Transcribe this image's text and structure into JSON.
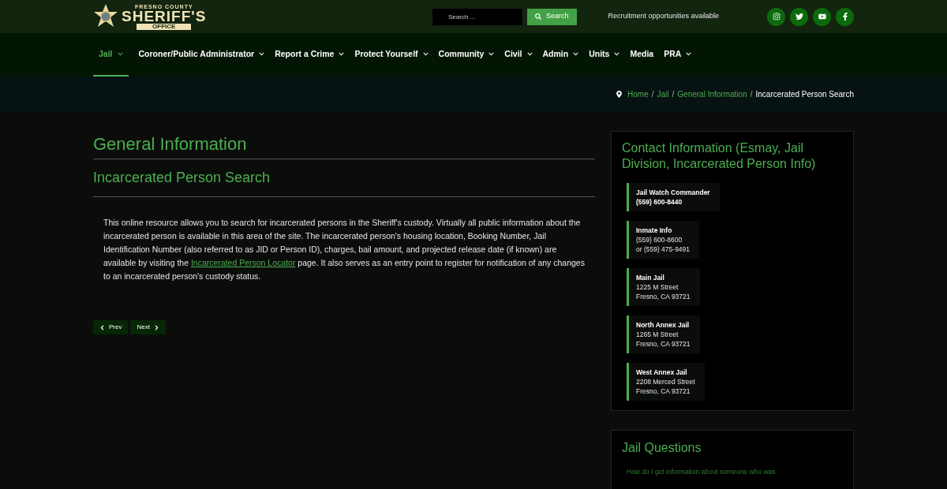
{
  "logo": {
    "top": "FRESNO COUNTY",
    "main": "SHERIFF'S",
    "bottom": "OFFICE"
  },
  "search": {
    "placeholder": "Search ...",
    "button": "Search"
  },
  "recruitment": "Recruitment opportunities available",
  "nav": [
    {
      "label": "Jail",
      "selected": true,
      "dropdown": true
    },
    {
      "label": "Coroner/Public Administrator",
      "selected": false,
      "dropdown": true
    },
    {
      "label": "Report a Crime",
      "selected": false,
      "dropdown": true
    },
    {
      "label": "Protect Yourself",
      "selected": false,
      "dropdown": true
    },
    {
      "label": "Community",
      "selected": false,
      "dropdown": true
    },
    {
      "label": "Civil",
      "selected": false,
      "dropdown": true
    },
    {
      "label": "Admin",
      "selected": false,
      "dropdown": true
    },
    {
      "label": "Units",
      "selected": false,
      "dropdown": true
    },
    {
      "label": "Media",
      "selected": false,
      "dropdown": false
    },
    {
      "label": "PRA",
      "selected": false,
      "dropdown": true
    }
  ],
  "breadcrumb": [
    {
      "label": "Home",
      "separator": "/"
    },
    {
      "label": "Jail",
      "separator": "/"
    },
    {
      "label": "General Information",
      "separator": "/"
    },
    {
      "label": "Incarcerated Person Search"
    }
  ],
  "main": {
    "title": "General Information",
    "subtitle": "Incarcerated Person Search",
    "paragraph": {
      "before": "This online resource allows you to search for incarcerated persons in the Sheriff's custody. Virtually all public information about the incarcerated person is available in this area of the site. The incarcerated person's housing location, Booking Number, Jail Identification Number (also referred to as JID or Person ID), charges, bail amount, and projected release date (if known) are available by visiting the",
      "link": "Incarcerated Person Locator",
      "after": "page. It also serves as an entry point to register for notification of any changes to an incarcerated person's custody status."
    },
    "prev": "Prev",
    "next": "Next"
  },
  "contact": {
    "title": "Contact Information (Esmay, Jail Division, Incarcerated Person Info)",
    "entries": [
      {
        "name": "Jail Watch Commander",
        "lines": [
          "(559) 600-8440"
        ]
      },
      {
        "name": "Inmate Info",
        "lines": [
          "(559) 600-8600",
          "or (559) 475-9491"
        ]
      },
      {
        "name": "Main Jail",
        "lines": [
          "1225 M Street",
          "Fresno, CA 93721"
        ]
      },
      {
        "name": "North Annex Jail",
        "lines": [
          "1265 M Street",
          "Fresno, CA 93721"
        ]
      },
      {
        "name": "West Annex Jail",
        "lines": [
          "2208 Merced Street",
          "Fresno, CA 93721"
        ]
      }
    ]
  },
  "questions": {
    "title": "Jail Questions",
    "items": [
      "How do I get information about someone who was"
    ]
  }
}
